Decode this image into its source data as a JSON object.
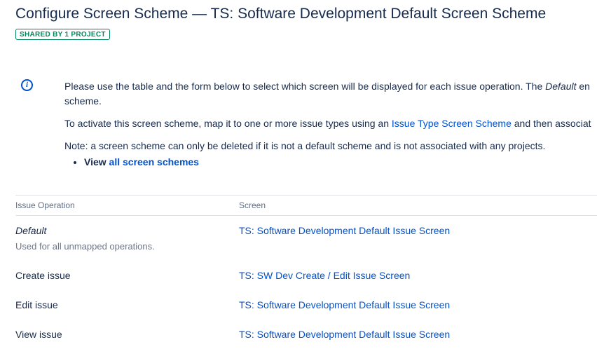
{
  "header": {
    "title": "Configure Screen Scheme — TS: Software Development Default Screen Scheme",
    "badge": "SHARED BY 1 PROJECT"
  },
  "info": {
    "p1": {
      "before": "Please use the table and the form below to select which screen will be displayed for each issue operation. The ",
      "em": "Default",
      "after": " en",
      "line2": "scheme."
    },
    "p2": {
      "before": "To activate this screen scheme, map it to one or more issue types using an ",
      "link": "Issue Type Screen Scheme",
      "after": " and then associat"
    },
    "p3": "Note: a screen scheme can only be deleted if it is not a default scheme and is not associated with any projects.",
    "bullet": {
      "bold": "View",
      "link": "all screen schemes"
    }
  },
  "table": {
    "headers": [
      "Issue Operation",
      "Screen"
    ],
    "rows": [
      {
        "operation": "Default",
        "description": "Used for all unmapped operations.",
        "screen": "TS: Software Development Default Issue Screen"
      },
      {
        "operation": "Create issue",
        "screen": "TS: SW Dev Create / Edit Issue Screen"
      },
      {
        "operation": "Edit issue",
        "screen": "TS: Software Development Default Issue Screen"
      },
      {
        "operation": "View issue",
        "screen": "TS: Software Development Default Issue Screen"
      }
    ]
  },
  "colors": {
    "link": "#0052CC",
    "badge_green": "#00875A",
    "heading": "#172B4D"
  }
}
